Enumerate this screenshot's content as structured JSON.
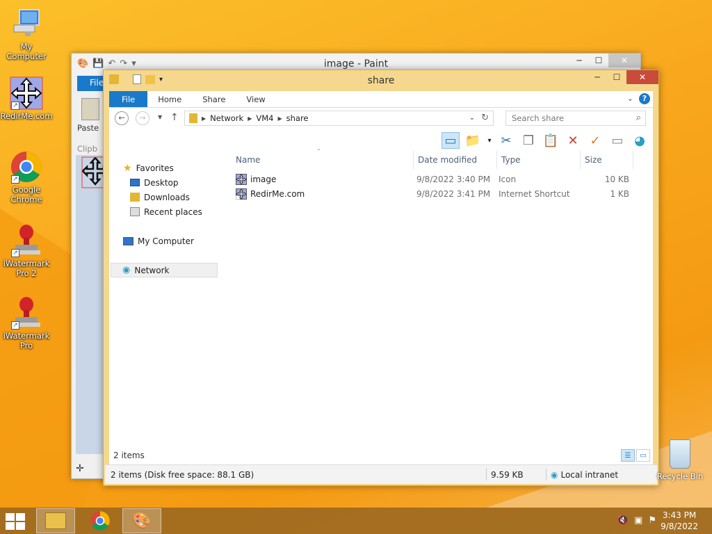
{
  "desktop": {
    "icons": [
      {
        "label": "My Computer",
        "icon": "my-computer-icon"
      },
      {
        "label": "RedirMe.com",
        "icon": "move-arrows-icon"
      },
      {
        "label": "Google Chrome",
        "icon": "chrome-icon"
      },
      {
        "label": "iWatermark Pro 2",
        "icon": "stamp-icon"
      },
      {
        "label": "iWatermark Pro",
        "icon": "stamp-icon"
      }
    ],
    "recycle_bin": "Recycle Bin"
  },
  "paint": {
    "title": "image - Paint",
    "file_tab": "File",
    "paste": "Paste",
    "clipboard": "Clipb"
  },
  "explorer": {
    "title": "share",
    "ribbon_tabs": [
      "File",
      "Home",
      "Share",
      "View"
    ],
    "help": "?",
    "address": [
      "Network",
      "VM4",
      "share"
    ],
    "search_placeholder": "Search share",
    "nav": {
      "favorites": "Favorites",
      "desktop": "Desktop",
      "downloads": "Downloads",
      "recent": "Recent places",
      "computer": "My Computer",
      "network": "Network"
    },
    "columns": [
      "Name",
      "Date modified",
      "Type",
      "Size"
    ],
    "files": [
      {
        "name": "image",
        "date": "9/8/2022 3:40 PM",
        "type": "Icon",
        "size": "10 KB"
      },
      {
        "name": "RedirMe.com",
        "date": "9/8/2022 3:41 PM",
        "type": "Internet Shortcut",
        "size": "1 KB"
      }
    ],
    "items_count": "2 items",
    "status_left": "2 items (Disk free space: 88.1 GB)",
    "status_size": "9.59 KB",
    "status_zone": "Local intranet"
  },
  "taskbar": {
    "time": "3:43 PM",
    "date": "9/8/2022"
  },
  "colors": {
    "accent": "#1979ca",
    "close_red": "#c74c3c",
    "frame": "#f5d88e"
  }
}
